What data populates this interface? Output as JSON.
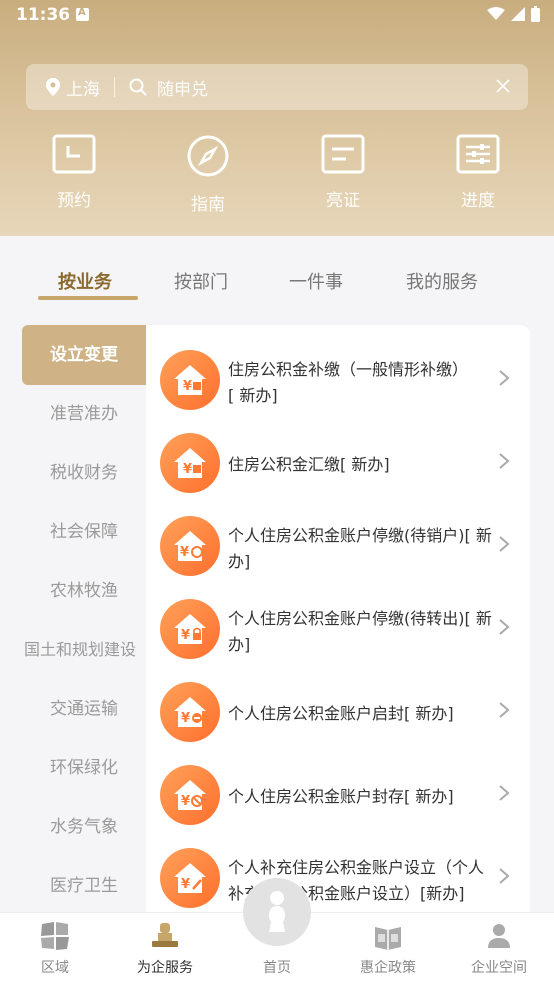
{
  "status": {
    "time": "11:36"
  },
  "search": {
    "city": "上海",
    "placeholder": "随申兑"
  },
  "quick": [
    {
      "label": "预约",
      "icon": "calendar-icon"
    },
    {
      "label": "指南",
      "icon": "compass-icon"
    },
    {
      "label": "亮证",
      "icon": "certificate-icon"
    },
    {
      "label": "进度",
      "icon": "progress-icon"
    }
  ],
  "tabs": [
    {
      "label": "按业务",
      "active": true
    },
    {
      "label": "按部门",
      "active": false
    },
    {
      "label": "一件事",
      "active": false
    },
    {
      "label": "我的服务",
      "active": false
    }
  ],
  "sidebar": [
    {
      "label": "设立变更",
      "active": true
    },
    {
      "label": "准营准办"
    },
    {
      "label": "税收财务"
    },
    {
      "label": "社会保障"
    },
    {
      "label": "农林牧渔"
    },
    {
      "label": "国土和规划建设"
    },
    {
      "label": "交通运输"
    },
    {
      "label": "环保绿化"
    },
    {
      "label": "水务气象"
    },
    {
      "label": "医疗卫生"
    }
  ],
  "services": [
    {
      "line1": "住房公积金补缴（一般情形补缴）",
      "line2": "[ 新办]"
    },
    {
      "line1": "住房公积金汇缴[ 新办]",
      "line2": ""
    },
    {
      "line1": "个人住房公积金账户停缴(待销户)[ 新",
      "line2": "办]"
    },
    {
      "line1": "个人住房公积金账户停缴(待转出)[ 新",
      "line2": "办]"
    },
    {
      "line1": "个人住房公积金账户启封[ 新办]",
      "line2": ""
    },
    {
      "line1": "个人住房公积金账户封存[ 新办]",
      "line2": ""
    },
    {
      "line1": "个人补充住房公积金账户设立（个人",
      "line2": "补充住房公积金账户设立）[新办]"
    }
  ],
  "bottom_nav": [
    {
      "label": "区域",
      "icon": "region-icon"
    },
    {
      "label": "为企服务",
      "icon": "enterprise-service-icon",
      "active": true
    },
    {
      "label": "首页",
      "icon": "home-icon"
    },
    {
      "label": "惠企政策",
      "icon": "policy-icon"
    },
    {
      "label": "企业空间",
      "icon": "enterprise-space-icon"
    }
  ],
  "colors": {
    "accent": "#c6a66b",
    "icon_orange": "#ff7a35"
  }
}
